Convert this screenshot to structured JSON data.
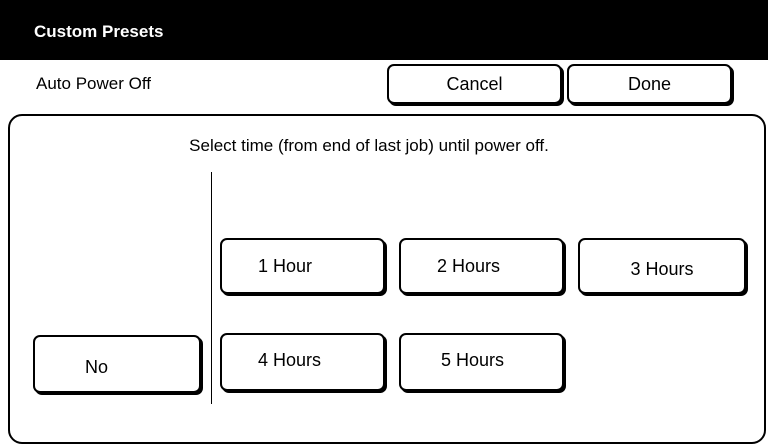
{
  "window": {
    "title": "Custom Presets"
  },
  "header": {
    "setting_label": "Auto Power Off",
    "cancel_label": "Cancel",
    "done_label": "Done"
  },
  "panel": {
    "instruction": "Select time (from end of last job) until power off.",
    "options": {
      "no": "No",
      "h1": "1 Hour",
      "h2": "2 Hours",
      "h3": "3 Hours",
      "h4": "4 Hours",
      "h5": "5 Hours"
    }
  }
}
